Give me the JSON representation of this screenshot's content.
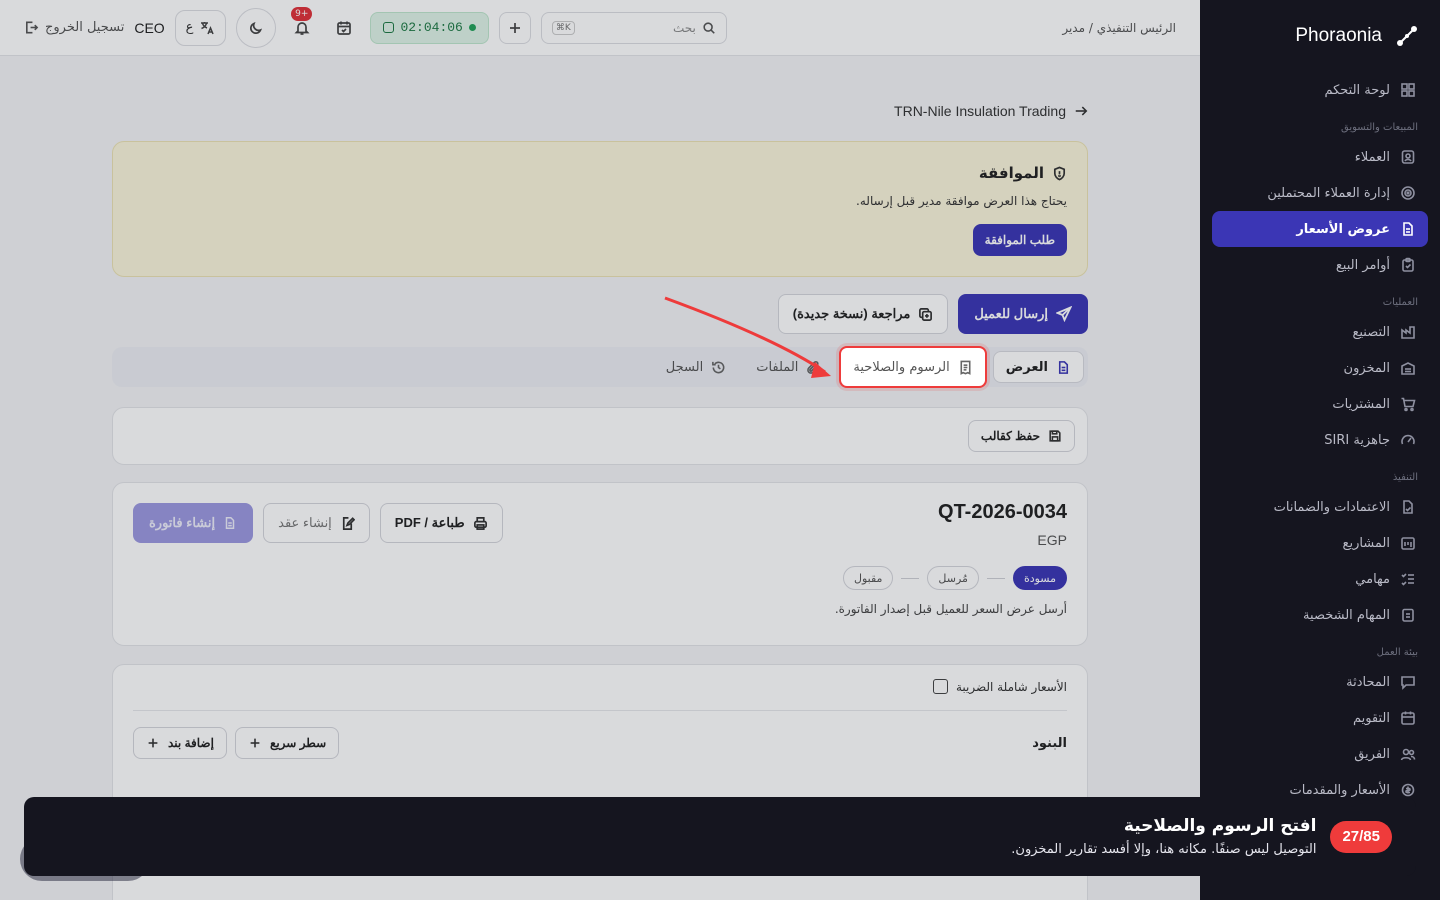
{
  "sidebar": {
    "brand": "Phoraonia",
    "groups": [
      {
        "heading": "",
        "items": [
          {
            "label": "لوحة التحكم",
            "icon": "dashboard-icon"
          }
        ]
      },
      {
        "heading": "المبيعات والتسويق",
        "items": [
          {
            "label": "العملاء",
            "icon": "contacts-icon"
          },
          {
            "label": "إدارة العملاء المحتملين",
            "icon": "target-icon"
          },
          {
            "label": "عروض الأسعار",
            "icon": "document-icon",
            "active": true
          },
          {
            "label": "أوامر البيع",
            "icon": "clipboard-check-icon"
          }
        ]
      },
      {
        "heading": "العمليات",
        "items": [
          {
            "label": "التصنيع",
            "icon": "factory-icon"
          },
          {
            "label": "المخزون",
            "icon": "warehouse-icon"
          },
          {
            "label": "المشتريات",
            "icon": "cart-icon"
          },
          {
            "label": "جاهزية SIRI",
            "icon": "gauge-icon"
          }
        ]
      },
      {
        "heading": "التنفيذ",
        "items": [
          {
            "label": "الاعتمادات والضمانات",
            "icon": "file-check-icon"
          },
          {
            "label": "المشاريع",
            "icon": "projects-icon"
          },
          {
            "label": "مهامي",
            "icon": "tasks-icon"
          },
          {
            "label": "المهام الشخصية",
            "icon": "personal-tasks-icon"
          }
        ]
      },
      {
        "heading": "بيئة العمل",
        "items": [
          {
            "label": "المحادثة",
            "icon": "chat-icon"
          },
          {
            "label": "التقويم",
            "icon": "calendar-icon"
          },
          {
            "label": "الفريق",
            "icon": "team-icon"
          },
          {
            "label": "الأسعار والمقدمات",
            "icon": "prices-icon"
          }
        ]
      }
    ]
  },
  "topbar": {
    "role_breadcrumb": "الرئيس التنفيذي / مدير",
    "search_placeholder": "بحث",
    "search_shortcut": "K⌘",
    "timer": "02:04:06",
    "notifications_badge": "+9",
    "lang_label": "ع",
    "user_role": "CEO",
    "logout_label": "تسجيل الخروج"
  },
  "page": {
    "back_link": "TRN-Nile Insulation Trading",
    "approval": {
      "title": "الموافقة",
      "text": "يحتاج هذا العرض موافقة مدير قبل إرساله.",
      "button": "طلب الموافقة"
    },
    "actions": {
      "send": "إرسال للعميل",
      "revise": "مراجعة (نسخة جديدة)"
    },
    "tabs": [
      {
        "label": "العرض",
        "icon": "document-icon",
        "state": "active"
      },
      {
        "label": "الرسوم والصلاحية",
        "icon": "receipt-icon",
        "state": "highlighted"
      },
      {
        "label": "الملفات",
        "icon": "paperclip-icon",
        "state": "normal"
      },
      {
        "label": "السجل",
        "icon": "history-icon",
        "state": "normal"
      }
    ],
    "save_template": "حفظ كقالب",
    "quote": {
      "number": "QT-2026-0034",
      "currency": "EGP",
      "print": "طباعة / PDF",
      "create_contract": "إنشاء عقد",
      "create_invoice": "إنشاء فاتورة",
      "stages": [
        "مسودة",
        "مُرسل",
        "مقبول"
      ],
      "current_stage": 0,
      "hint": "أرسل عرض السعر للعميل قبل إصدار الفاتورة."
    },
    "items": {
      "tax_inclusive": "الأسعار شاملة الضريبة",
      "title": "البنود",
      "quick_line": "سطر سريع",
      "add_item": "إضافة بند"
    }
  },
  "tour": {
    "counter": "27/85",
    "title": "افتح الرسوم والصلاحية",
    "text": "التوصيل ليس صنفًا. مكانه هنا، وإلا أفسد تقارير المخزون."
  },
  "colors": {
    "accent": "#3b36b5",
    "highlight": "#ee3b3b",
    "sidebar_bg": "#15151f"
  }
}
